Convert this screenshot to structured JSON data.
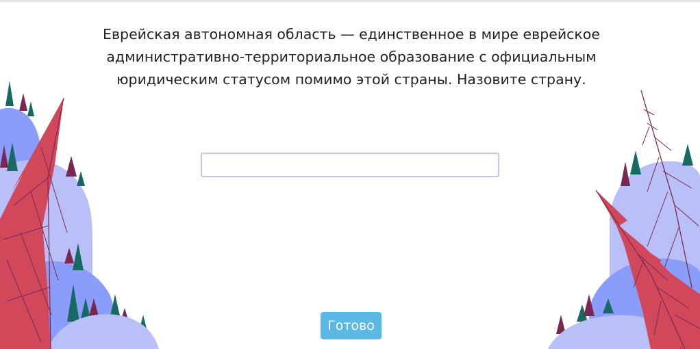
{
  "question": {
    "text": "Еврейская автономная область — единственное в мире еврейское административно-территориальное образование с официальным юридическим статусом помимо этой страны. Назовите страну."
  },
  "answer": {
    "value": "",
    "placeholder": ""
  },
  "done_button": {
    "label": "Готово"
  },
  "colors": {
    "accent": "#5bb8e2",
    "input_border": "#c5c4f2",
    "leaf_red": "#d0485a",
    "hill_light": "#b9bff7",
    "hill_mid": "#8b9dfa",
    "tree_green": "#176a64",
    "tree_plum": "#7a2851"
  }
}
